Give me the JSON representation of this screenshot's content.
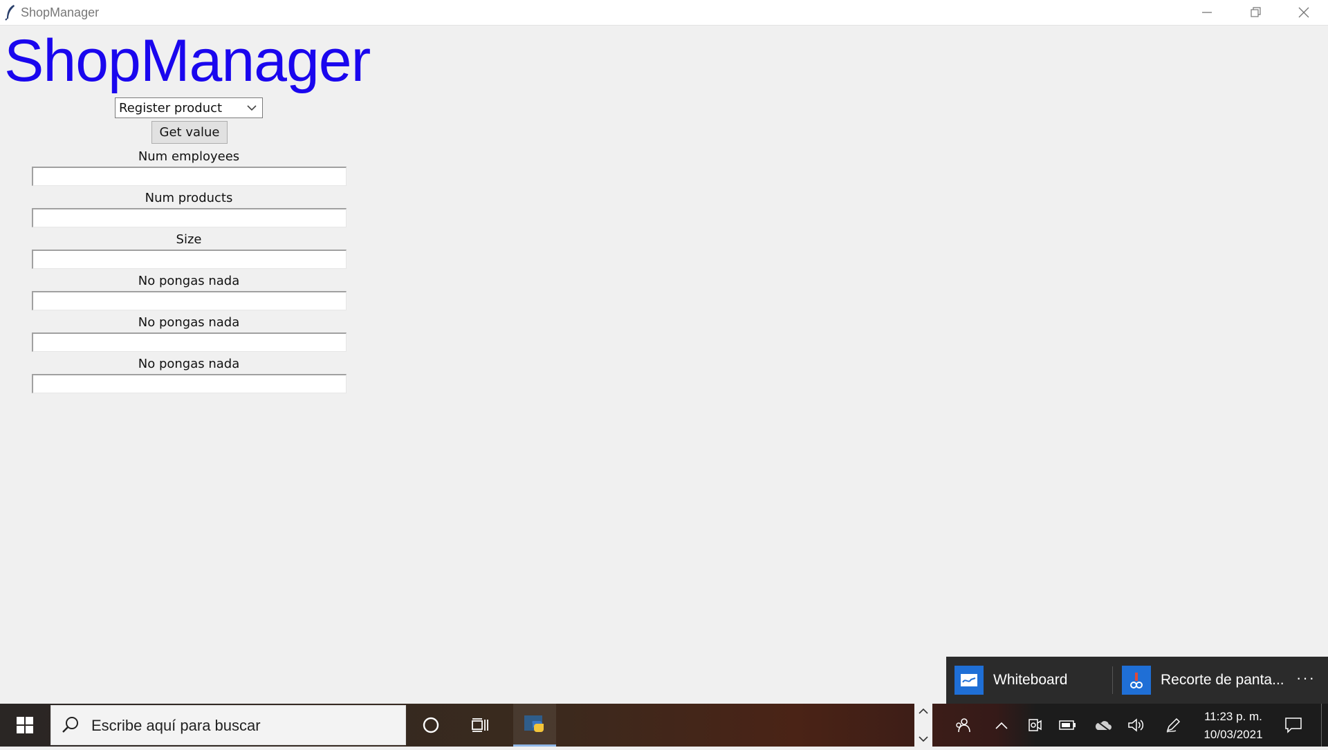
{
  "window": {
    "title": "ShopManager",
    "icon": "feather-icon",
    "controls": [
      "minimize-icon",
      "restore-icon",
      "close-icon"
    ]
  },
  "app": {
    "heading": "ShopManager",
    "heading_color": "#1a06ee",
    "dropdown": {
      "selected": "Register product"
    },
    "get_value_label": "Get value",
    "fields": [
      {
        "label": "Num employees",
        "value": ""
      },
      {
        "label": "Num products",
        "value": ""
      },
      {
        "label": "Size",
        "value": ""
      },
      {
        "label": "No pongas nada",
        "value": ""
      },
      {
        "label": "No pongas nada",
        "value": ""
      },
      {
        "label": "No pongas nada",
        "value": ""
      }
    ]
  },
  "notifications": {
    "items": [
      {
        "label": "Whiteboard",
        "icon": "whiteboard-icon"
      },
      {
        "label": "Recorte de panta...",
        "icon": "snip-icon"
      }
    ],
    "more": "···"
  },
  "taskbar": {
    "search_placeholder": "Escribe aquí para buscar",
    "time": "11:23 p. m.",
    "date": "10/03/2021",
    "accent": "#1c1c1c"
  }
}
